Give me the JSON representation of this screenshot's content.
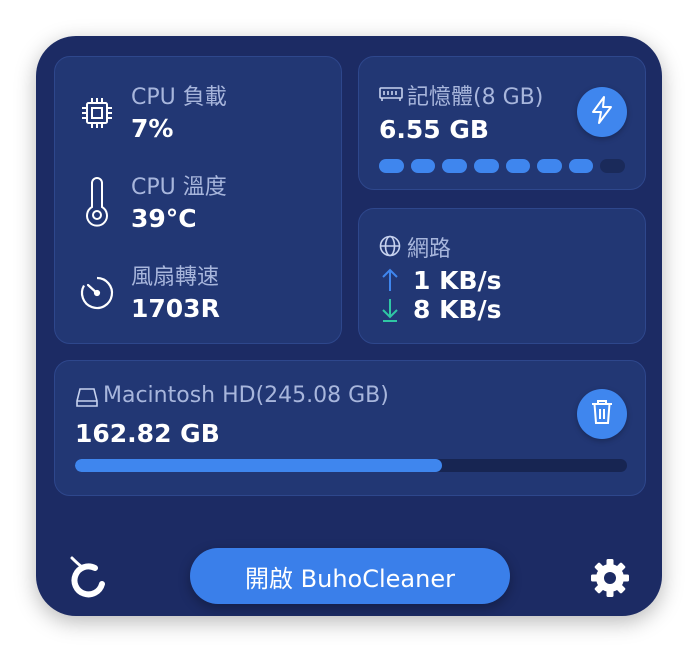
{
  "cpu": {
    "load_label": "CPU 負載",
    "load_value": "7%",
    "temp_label": "CPU 溫度",
    "temp_value": "39°C",
    "fan_label": "風扇轉速",
    "fan_value": "1703R",
    "icons": [
      "chip-icon",
      "thermometer-icon",
      "fan-gauge-icon"
    ]
  },
  "memory": {
    "label": "記憶體(8 GB)",
    "value": "6.55 GB",
    "usage_fraction": 0.82,
    "segments_total": 8,
    "segments_filled": 7,
    "icons": [
      "memory-icon",
      "lightning-icon"
    ]
  },
  "network": {
    "label": "網路",
    "upload": "1 KB/s",
    "download": "8 KB/s",
    "icons": [
      "globe-icon",
      "arrow-up-icon",
      "arrow-down-icon"
    ]
  },
  "disk": {
    "label": "Macintosh HD(245.08 GB)",
    "value": "162.82 GB",
    "usage_fraction": 0.664,
    "icons": [
      "disk-icon",
      "trash-icon"
    ]
  },
  "footer": {
    "open_button": "開啟 BuhoCleaner",
    "icons": [
      "buho-logo-icon",
      "gear-icon"
    ]
  },
  "colors": {
    "window_bg": "#1c2b64",
    "card_bg": "#223774",
    "accent": "#3f86ee",
    "download_green": "#2fc7a4",
    "label_text": "#a8b6dc"
  }
}
